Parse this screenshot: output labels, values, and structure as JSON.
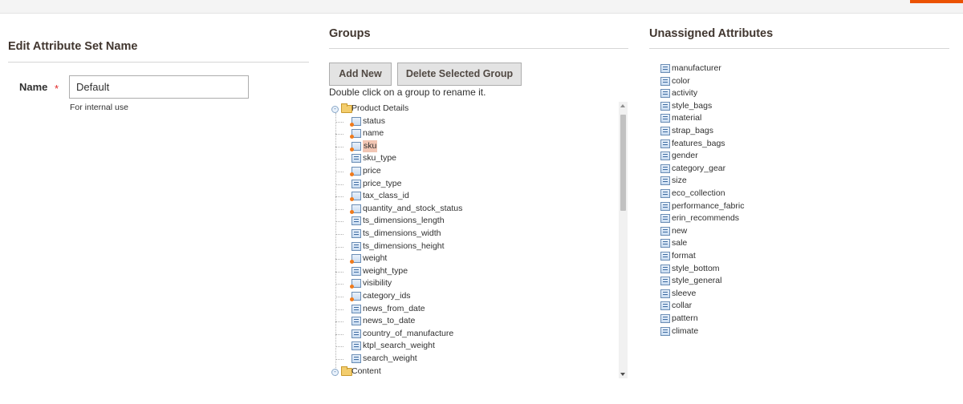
{
  "colors": {
    "accent": "#eb5202",
    "selected_bg": "#f2c6b4",
    "required_star": "#e22626"
  },
  "left": {
    "title": "Edit Attribute Set Name",
    "name_label": "Name",
    "required_marker": "*",
    "name_value": "Default",
    "hint": "For internal use"
  },
  "groups": {
    "title": "Groups",
    "add_new_label": "Add New",
    "delete_label": "Delete Selected Group",
    "hint": "Double click on a group to rename it.",
    "tree": [
      {
        "label": "Product Details",
        "type": "group",
        "icon": "folder-icon"
      },
      {
        "label": "status",
        "type": "attr",
        "icon": "system-attribute-icon"
      },
      {
        "label": "name",
        "type": "attr",
        "icon": "system-attribute-icon"
      },
      {
        "label": "sku",
        "type": "attr",
        "icon": "system-attribute-icon",
        "selected": true
      },
      {
        "label": "sku_type",
        "type": "attr",
        "icon": "attribute-icon"
      },
      {
        "label": "price",
        "type": "attr",
        "icon": "system-attribute-icon"
      },
      {
        "label": "price_type",
        "type": "attr",
        "icon": "attribute-icon"
      },
      {
        "label": "tax_class_id",
        "type": "attr",
        "icon": "system-attribute-icon"
      },
      {
        "label": "quantity_and_stock_status",
        "type": "attr",
        "icon": "system-attribute-icon"
      },
      {
        "label": "ts_dimensions_length",
        "type": "attr",
        "icon": "attribute-icon"
      },
      {
        "label": "ts_dimensions_width",
        "type": "attr",
        "icon": "attribute-icon"
      },
      {
        "label": "ts_dimensions_height",
        "type": "attr",
        "icon": "attribute-icon"
      },
      {
        "label": "weight",
        "type": "attr",
        "icon": "system-attribute-icon"
      },
      {
        "label": "weight_type",
        "type": "attr",
        "icon": "attribute-icon"
      },
      {
        "label": "visibility",
        "type": "attr",
        "icon": "system-attribute-icon"
      },
      {
        "label": "category_ids",
        "type": "attr",
        "icon": "system-attribute-icon"
      },
      {
        "label": "news_from_date",
        "type": "attr",
        "icon": "attribute-icon"
      },
      {
        "label": "news_to_date",
        "type": "attr",
        "icon": "attribute-icon"
      },
      {
        "label": "country_of_manufacture",
        "type": "attr",
        "icon": "attribute-icon"
      },
      {
        "label": "ktpl_search_weight",
        "type": "attr",
        "icon": "attribute-icon"
      },
      {
        "label": "search_weight",
        "type": "attr",
        "icon": "attribute-icon"
      },
      {
        "label": "Content",
        "type": "group",
        "icon": "folder-icon"
      }
    ]
  },
  "unassigned": {
    "title": "Unassigned Attributes",
    "items": [
      "manufacturer",
      "color",
      "activity",
      "style_bags",
      "material",
      "strap_bags",
      "features_bags",
      "gender",
      "category_gear",
      "size",
      "eco_collection",
      "performance_fabric",
      "erin_recommends",
      "new",
      "sale",
      "format",
      "style_bottom",
      "style_general",
      "sleeve",
      "collar",
      "pattern",
      "climate"
    ]
  }
}
